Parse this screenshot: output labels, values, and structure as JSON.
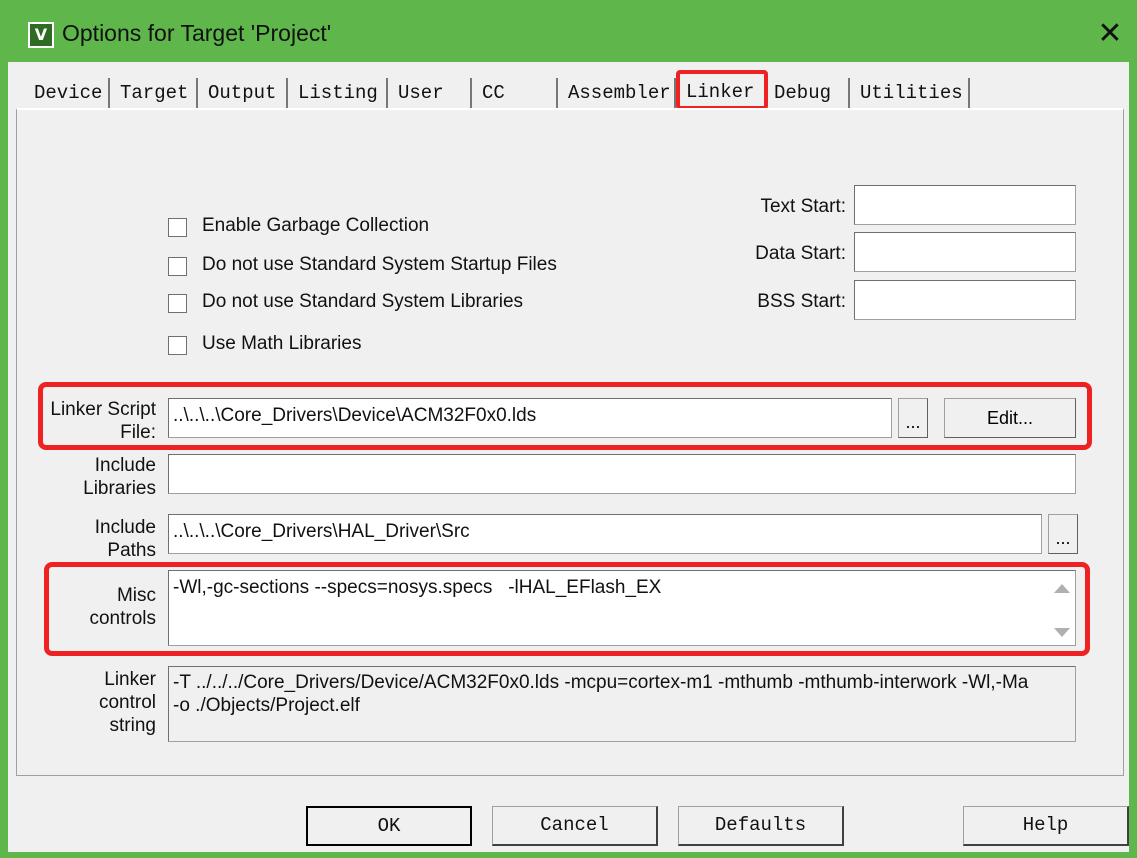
{
  "window": {
    "title": "Options for Target 'Project'",
    "icon": "keil-uvision-icon",
    "close_glyph": "✕"
  },
  "tabs": [
    {
      "label": "Device",
      "active": false
    },
    {
      "label": "Target",
      "active": false
    },
    {
      "label": "Output",
      "active": false
    },
    {
      "label": "Listing",
      "active": false
    },
    {
      "label": "User",
      "active": false
    },
    {
      "label": "CC",
      "active": false
    },
    {
      "label": "Assembler",
      "active": false
    },
    {
      "label": "Linker",
      "active": true
    },
    {
      "label": "Debug",
      "active": false
    },
    {
      "label": "Utilities",
      "active": false
    }
  ],
  "checkboxes": [
    {
      "label": "Enable Garbage Collection",
      "checked": false
    },
    {
      "label": "Do not use Standard System Startup Files",
      "checked": false
    },
    {
      "label": "Do not use Standard System Libraries",
      "checked": false
    },
    {
      "label": "Use Math Libraries",
      "checked": false
    }
  ],
  "addresses": {
    "text_start_label": "Text Start:",
    "text_start_value": "",
    "data_start_label": "Data Start:",
    "data_start_value": "",
    "bss_start_label": "BSS Start:",
    "bss_start_value": ""
  },
  "linker_script": {
    "label_line1": "Linker Script",
    "label_line2": "File:",
    "value": "..\\..\\..\\Core_Drivers\\Device\\ACM32F0x0.lds",
    "browse_label": "...",
    "edit_label": "Edit..."
  },
  "include_libraries": {
    "label_line1": "Include",
    "label_line2": "Libraries",
    "value": ""
  },
  "include_paths": {
    "label_line1": "Include",
    "label_line2": "Paths",
    "value": "..\\..\\..\\Core_Drivers\\HAL_Driver\\Src",
    "browse_label": "..."
  },
  "misc_controls": {
    "label_line1": "Misc",
    "label_line2": "controls",
    "value": "-Wl,-gc-sections --specs=nosys.specs   -lHAL_EFlash_EX"
  },
  "linker_control": {
    "label_line1": "Linker",
    "label_line2": "control",
    "label_line3": "string",
    "line1": "-T ../../../Core_Drivers/Device/ACM32F0x0.lds -mcpu=cortex-m1 -mthumb -mthumb-interwork -Wl,-Ma",
    "line2": "-o ./Objects/Project.elf"
  },
  "buttons": {
    "ok": "OK",
    "cancel": "Cancel",
    "defaults": "Defaults",
    "help": "Help"
  },
  "colors": {
    "titlebar": "#5fb74b",
    "highlight": "#ee2222",
    "dialog_bg": "#f0f0f0"
  }
}
